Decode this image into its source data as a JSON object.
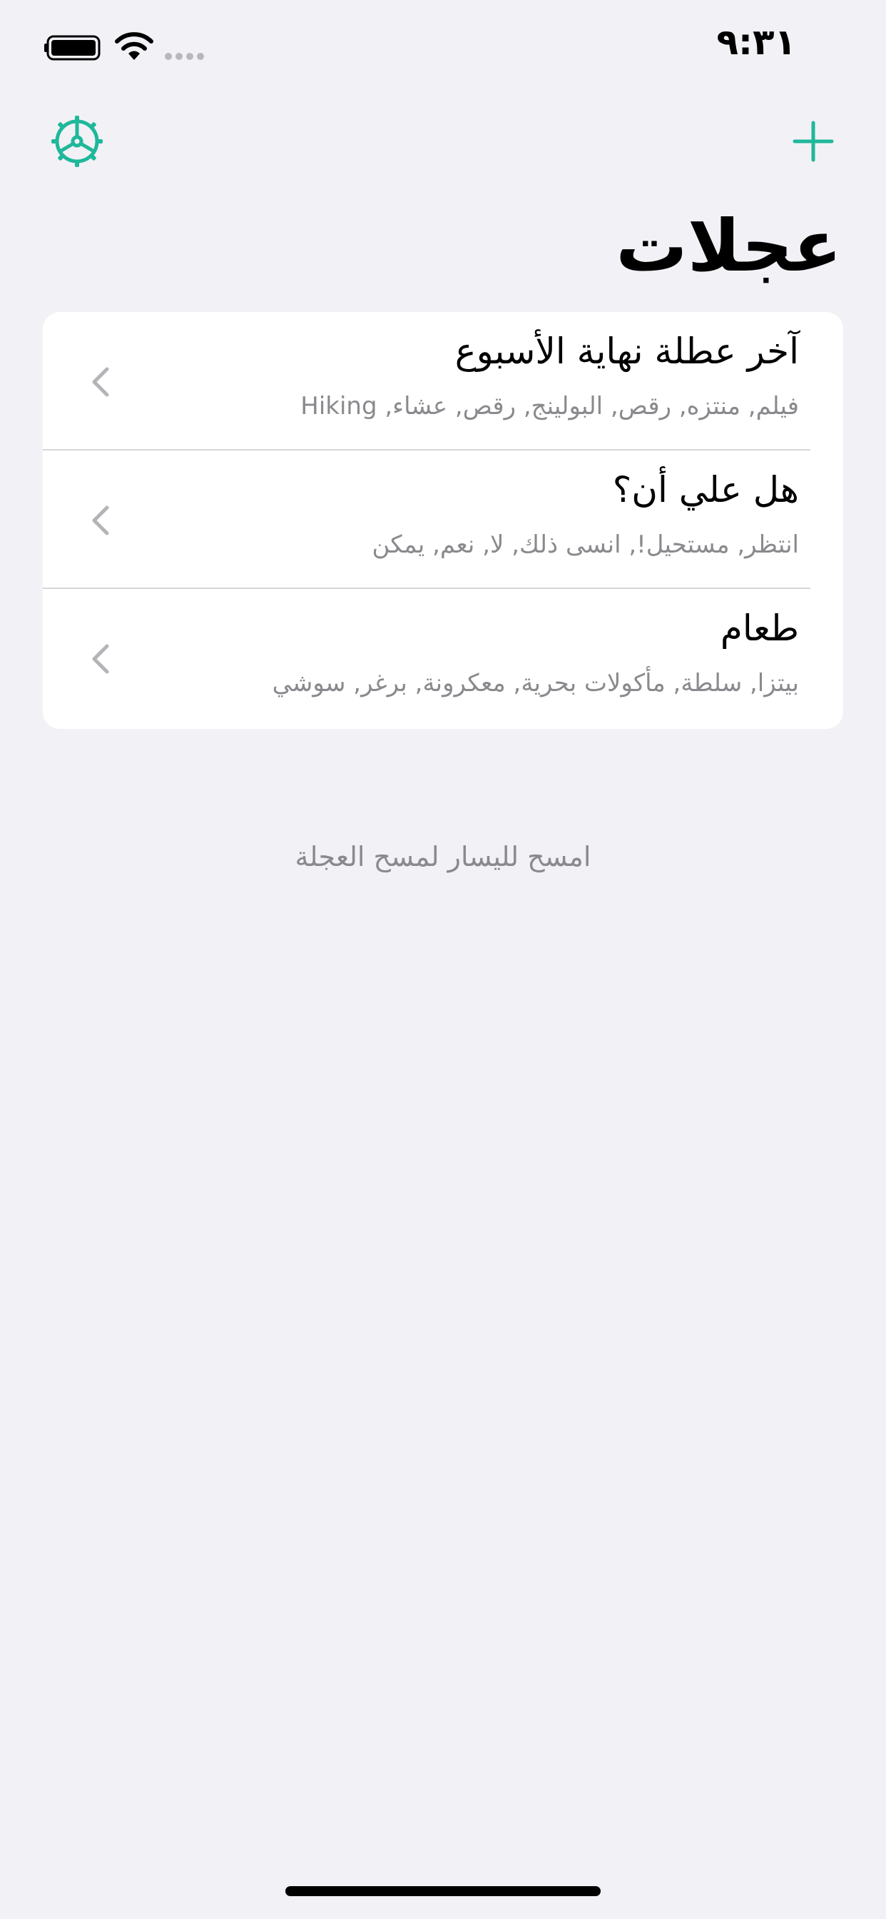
{
  "status_bar": {
    "time": "٩:٣١",
    "icons": [
      "battery-icon",
      "wifi-icon",
      "signal-icon"
    ]
  },
  "nav": {
    "settings_icon": "gear-icon",
    "add_icon": "plus-icon",
    "accent_color": "#1fb89a"
  },
  "title": "عجلات",
  "wheels": [
    {
      "title": "آخر عطلة نهاية الأسبوع",
      "options": "فيلم, منتزه, رقص, البولينج, رقص, عشاء, Hiking"
    },
    {
      "title": "هل علي أن؟",
      "options": "انتظر, مستحيل!, انسى ذلك, لا, نعم, يمكن"
    },
    {
      "title": "طعام",
      "options": "بيتزا, سلطة, مأكولات بحرية, معكرونة, برغر, سوشي"
    }
  ],
  "hint": "امسح لليسار لمسح العجلة"
}
